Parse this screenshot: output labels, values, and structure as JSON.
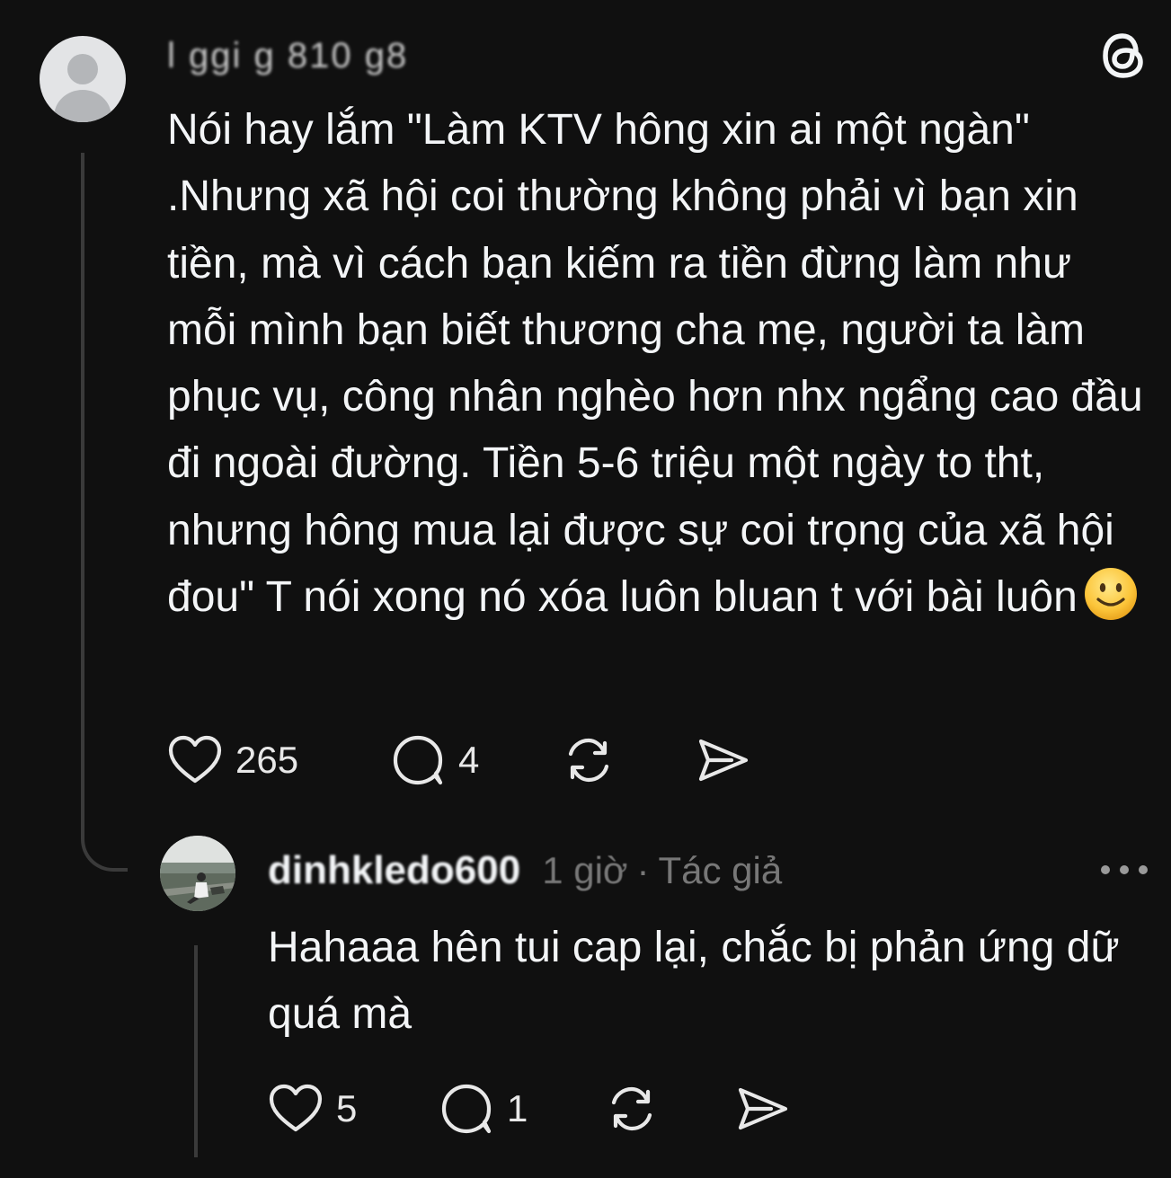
{
  "colors": {
    "background": "#101010",
    "text": "#f3f5f7",
    "muted": "#777777",
    "thread_line": "#3a3a3a"
  },
  "logo": {
    "icon": "threads-logo-icon"
  },
  "post": {
    "avatar_icon": "default-avatar-icon",
    "username": "l  ggi  g 810 g8",
    "text": "Nói hay lắm \"Làm KTV hông xin ai một ngàn\" .Nhưng xã hội coi thường không phải vì bạn xin tiền, mà vì cách bạn kiếm ra tiền đừng làm như mỗi mình bạn biết thương cha mẹ, người ta làm phục vụ, công nhân nghèo hơn nhx ngẩng cao đầu đi ngoài đường. Tiền 5-6 triệu một ngày to tht, nhưng hông mua lại được sự coi trọng của xã hội đou\" T nói xong nó xóa luôn bluan t với bài luôn",
    "emoji": "slightly-smiling-face-emoji",
    "actions": {
      "like_count": "265",
      "comment_count": "4",
      "icons": [
        "heart-icon",
        "comment-icon",
        "repost-icon",
        "share-icon"
      ]
    }
  },
  "reply": {
    "avatar_icon": "user-photo-avatar",
    "username": "dinhkledo600",
    "time": "1 giờ",
    "separator": "·",
    "author_tag": "Tác giả",
    "more_icon": "more-options-icon",
    "text": "Hahaaa hên tui cap lại, chắc bị phản ứng dữ quá mà",
    "actions": {
      "like_count": "5",
      "comment_count": "1",
      "icons": [
        "heart-icon",
        "comment-icon",
        "repost-icon",
        "share-icon"
      ]
    }
  }
}
